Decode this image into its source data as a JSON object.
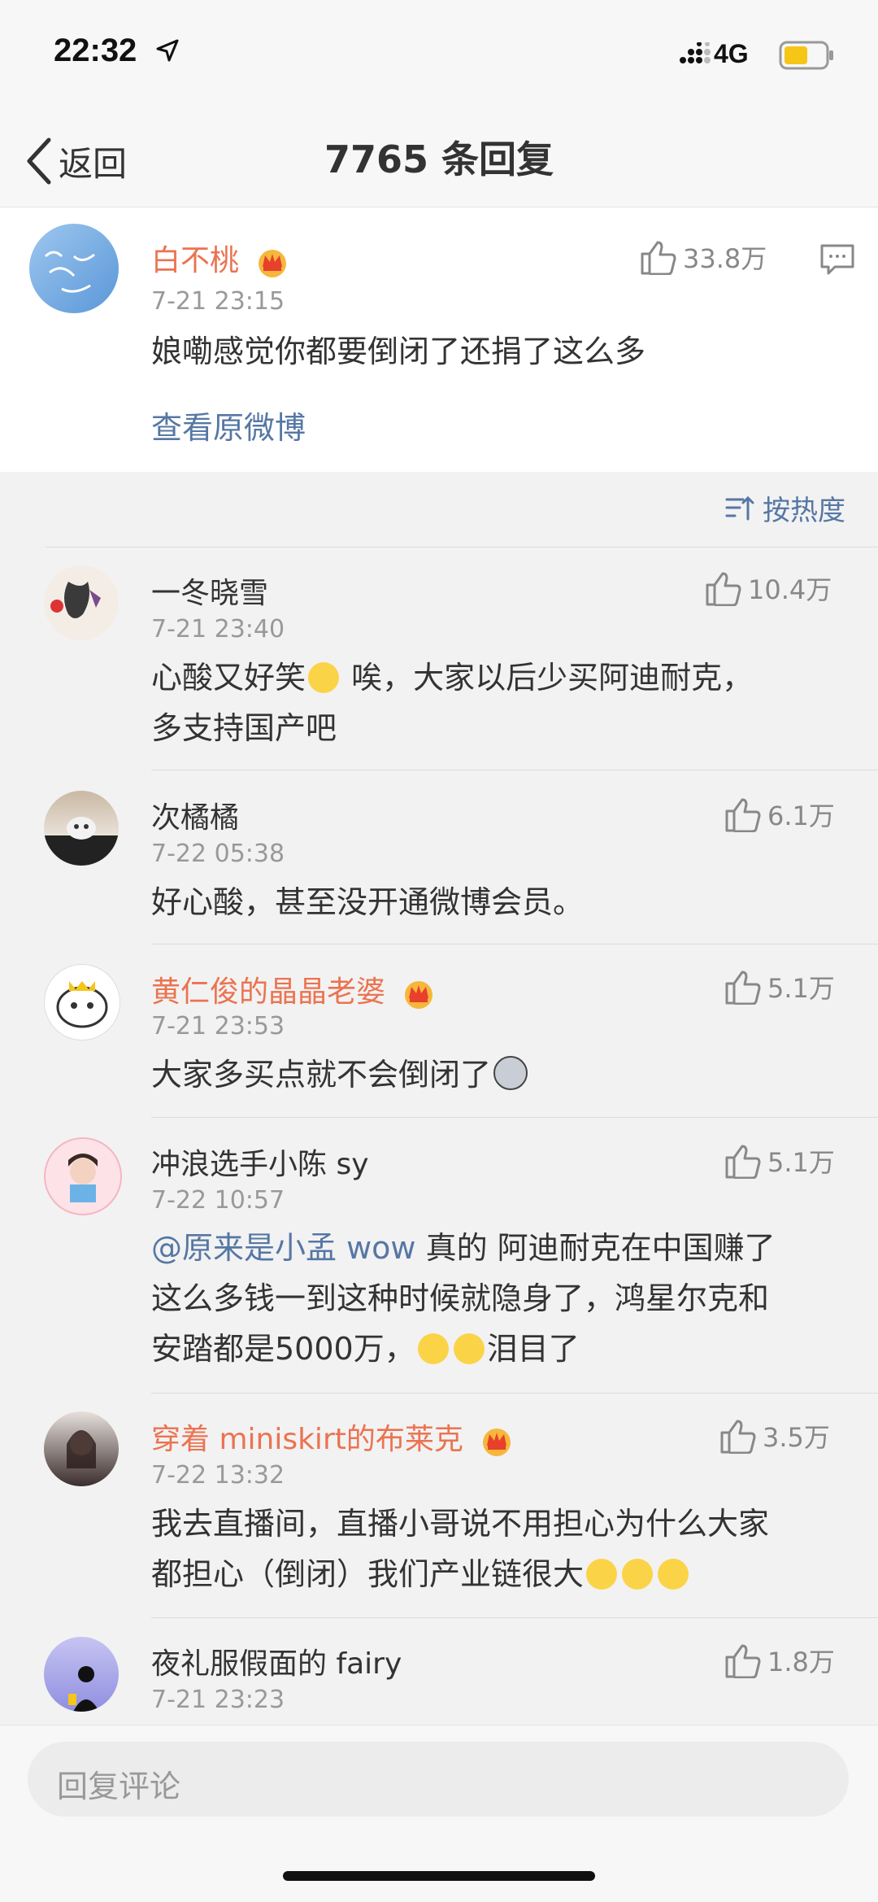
{
  "status": {
    "time": "22:32",
    "network": "4G"
  },
  "nav": {
    "back_label": "返回",
    "title": "7765 条回复"
  },
  "main_comment": {
    "user": "白不桃",
    "time": "7-21 23:15",
    "text": "娘嘞感觉你都要倒闭了还捐了这么多",
    "likes": "33.8万",
    "view_original": "查看原微博"
  },
  "sort_label": "按热度",
  "replies": [
    {
      "user": "一冬晓雪",
      "time": "7-21 23:40",
      "likes": "10.4万",
      "text1": "心酸又好笑",
      "text2": "唉，大家以后少买阿迪耐克，",
      "text3": "多支持国产吧"
    },
    {
      "user": "次橘橘",
      "time": "7-22 05:38",
      "likes": "6.1万",
      "text1": "好心酸，甚至没开通微博会员。"
    },
    {
      "user": "黄仁俊的晶晶老婆",
      "time": "7-21 23:53",
      "likes": "5.1万",
      "text1": "大家多买点就不会倒闭了"
    },
    {
      "user": "冲浪选手小陈 sy",
      "time": "7-22 10:57",
      "likes": "5.1万",
      "mention": "@原来是小孟 wow",
      "text1": " 真的 阿迪耐克在中国赚了",
      "text2": "这么多钱一到这种时候就隐身了，鸿星尔克和",
      "text3": "安踏都是5000万，",
      "text4": "泪目了"
    },
    {
      "user": "穿着 miniskirt的布莱克",
      "time": "7-22 13:32",
      "likes": "3.5万",
      "text1": "我去直播间，直播小哥说不用担心为什么大家",
      "text2": "都担心（倒闭）我们产业链很大"
    },
    {
      "user": "夜礼服假面的 fairy",
      "time": "7-21 23:23",
      "likes": "1.8万"
    }
  ],
  "reply_input": {
    "placeholder": "回复评论"
  },
  "colors": {
    "vip_name": "#eb7350",
    "link": "#5677a4",
    "secondary": "#999999"
  }
}
